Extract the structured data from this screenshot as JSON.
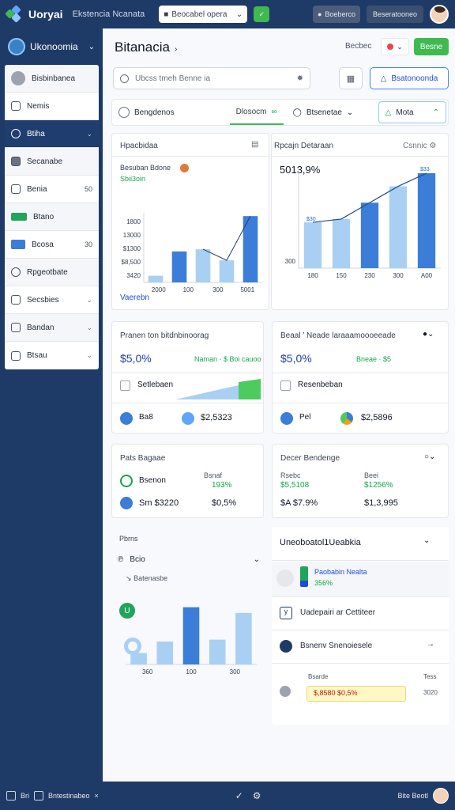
{
  "header": {
    "logo": "Uoryai",
    "subtitle": "Ekstencia Ncanata",
    "select_label": "Beocabel opera",
    "green_btn": "✓",
    "pill_label": "Boeberco",
    "pill2_label": "Beseratooneo"
  },
  "sidebar": {
    "title": "Ukonoomia",
    "items": [
      {
        "label": "Bisbinbanea",
        "num": "",
        "icon": "user-avatar"
      },
      {
        "label": "Nemis",
        "num": "",
        "icon": "folder-icon"
      },
      {
        "label": "Btiha",
        "num": "",
        "icon": "globe-icon",
        "active": true
      },
      {
        "label": "Secanabe",
        "num": "",
        "icon": "card-icon"
      },
      {
        "label": "Benia",
        "num": "50",
        "icon": "chart-icon"
      },
      {
        "label": "Btano",
        "num": "",
        "icon": "money-icon"
      },
      {
        "label": "Bcosa",
        "num": "30",
        "icon": "monitor-icon"
      },
      {
        "label": "Rpgeotbate",
        "num": "",
        "icon": "circle-icon"
      },
      {
        "label": "Secsbies",
        "num": "",
        "icon": "grid-icon"
      },
      {
        "label": "Bandan",
        "num": "",
        "icon": "doc-icon"
      },
      {
        "label": "Btsau",
        "num": "",
        "icon": "box-icon"
      }
    ]
  },
  "main": {
    "title": "Bitanacia",
    "header_label": "Becbec",
    "flag_label": "•",
    "header_button": "Besne",
    "search_placeholder": "Ubcss tmeh Benne ia",
    "outline_button": "Bsatonoonda",
    "filter": {
      "seg1": "Bengdenos",
      "tab": "Dlosocm",
      "seg2": "Btsenetae",
      "seg3": "Mota"
    }
  },
  "card1": {
    "title": "Hpacbidaa",
    "kpi_label": "Besuban Bdone",
    "kpi_sub": "Sbii3oin",
    "link": "Vaerebn"
  },
  "card2": {
    "title": "Rpcajn Detaraan",
    "action": "Csnnic",
    "kpi": "5013,9%"
  },
  "card3": {
    "title": "Pranen ton bitdnbinoorag",
    "kpi": "$5,0%",
    "kpi_sub": "Naman · $ Boi cauoo",
    "row1": "Setlebaen",
    "row2a": "Ba8",
    "row2b": "$2,5323"
  },
  "card4": {
    "title": "Beaal ’ Neade laraaamoooeeade",
    "kpi": "$5,0%",
    "kpi_sub": "Bneae · $5",
    "row1": "Resenbeban",
    "row2a": "Pel",
    "row2b": "$2,5896"
  },
  "card5": {
    "title": "Pats Bagaae",
    "col_label": "Bsnaf",
    "row1a": "Bsenon",
    "row1b": "193%",
    "row2a": "Sm $3220",
    "row2b": "$0,5%"
  },
  "card6": {
    "title": "Decer Bendenge",
    "col1": "Rsebc",
    "col2": "Beei",
    "r1c1": "$5,5108",
    "r1c2": "$1256%",
    "r2c1": "$A $7.9%",
    "r2c2": "$1,3,995"
  },
  "card7": {
    "title": "Pbrns",
    "select": "Bcio",
    "sub": "Batenasbe"
  },
  "card8": {
    "title": "Uneoboatol1Ueabkia",
    "item1": "Paobabin Nealta",
    "item1_sub": "356%",
    "item2": "Uadepairi ar Cettiteer",
    "item3": "Bsnenv Snenoiesele",
    "mini_label": "Bsarde",
    "mini_right": "Tess",
    "mini_value": "$,8580 $0,5%",
    "mini_value_right": "3020"
  },
  "chart_data": [
    {
      "type": "bar",
      "categories": [
        "1",
        "2",
        "3",
        "4",
        "5"
      ],
      "values": [
        3,
        14,
        15,
        10,
        30
      ],
      "y_ticks": [
        "3420",
        "$8,500",
        "$1300",
        "13000",
        "1800"
      ],
      "x_ticks": [
        "2000",
        "100",
        "300",
        "5001"
      ],
      "colors": [
        "#a9d0f2",
        "#3b7dd8",
        "#a9d0f2",
        "#a9d0f2",
        "#3b7dd8"
      ]
    },
    {
      "type": "bar",
      "categories": [
        "1",
        "2",
        "3",
        "4",
        "5"
      ],
      "values": [
        14,
        15,
        20,
        25,
        29
      ],
      "y_ticks": [
        "300"
      ],
      "x_ticks": [
        "180",
        "150",
        "230",
        "300",
        "A00"
      ],
      "colors": [
        "#a9d0f2",
        "#a9d0f2",
        "#3b7dd8",
        "#a9d0f2",
        "#3b7dd8"
      ],
      "point_labels": [
        "$30",
        "$33"
      ]
    },
    {
      "type": "bar",
      "categories": [
        "1",
        "2",
        "3",
        "4",
        "5"
      ],
      "values": [
        6,
        12,
        30,
        13,
        27
      ],
      "x_ticks": [
        "360",
        "100",
        "300"
      ],
      "colors": [
        "#a9d0f2",
        "#a9d0f2",
        "#3b7dd8",
        "#a9d0f2",
        "#a9d0f2"
      ]
    }
  ],
  "colors": {
    "primary": "#1e3a66",
    "accent": "#3fb950",
    "blue": "#3b7dd8",
    "lightblue": "#a9d0f2"
  },
  "footer": {
    "left1": "Bri",
    "left2": "Bntestinabeo",
    "right": "Bite Beotl"
  }
}
